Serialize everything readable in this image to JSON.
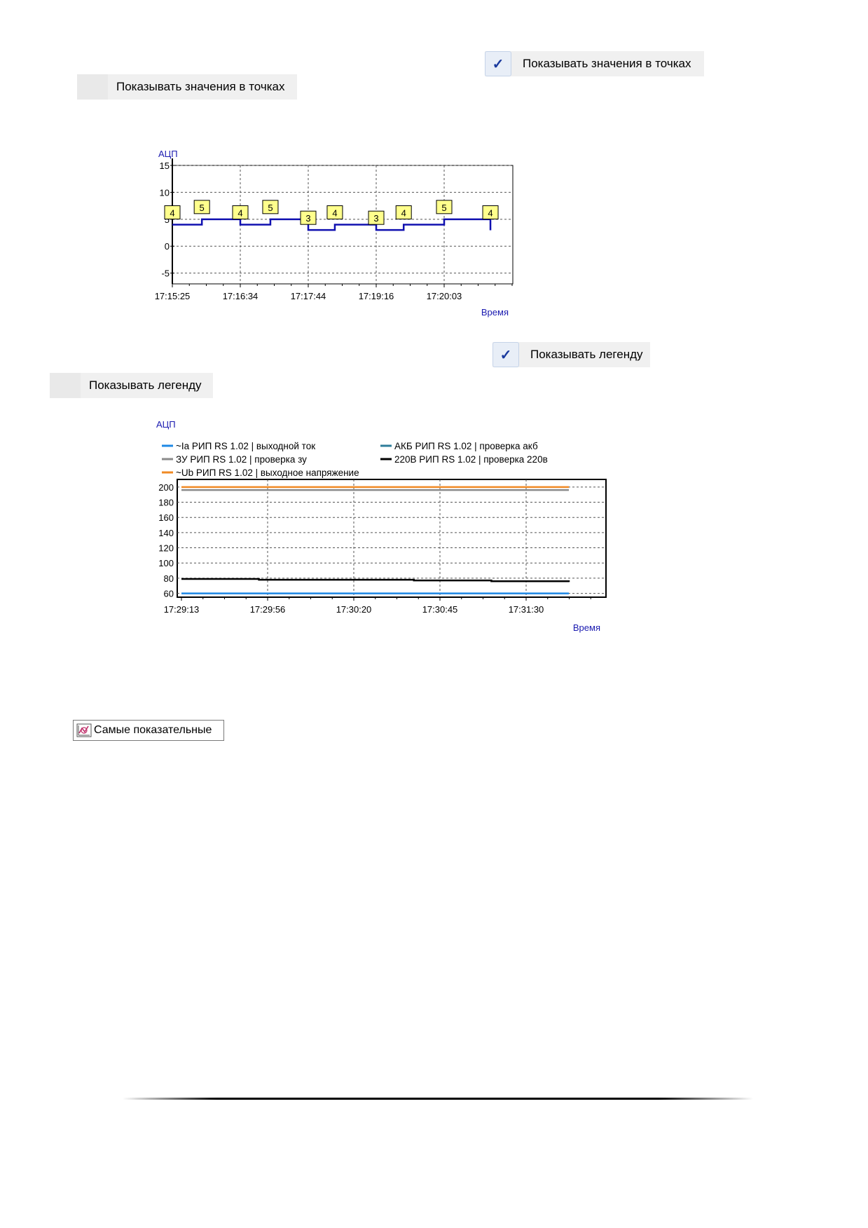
{
  "menu": {
    "show_values_checked": "Показывать значения в точках",
    "show_values_unchecked": "Показывать значения в точках",
    "show_legend_checked": "Показывать легенду",
    "show_legend_unchecked": "Показывать легенду",
    "check_glyph": "✓"
  },
  "toolbar": {
    "best_label": "Самые показательные"
  },
  "chart_data": [
    {
      "type": "line",
      "ylabel": "АЦП",
      "xlabel": "Время",
      "ylim": [
        -7,
        15
      ],
      "y_ticks": [
        15,
        10,
        5,
        0,
        -5
      ],
      "x_ticks": [
        "17:15:25",
        "17:16:34",
        "17:17:44",
        "17:19:16",
        "17:20:03"
      ],
      "grid": true,
      "legend": false,
      "series": [
        {
          "color": "#1010b0",
          "x": [
            "17:15:25",
            "17:15:55",
            "17:16:34",
            "17:17:05",
            "17:17:44",
            "17:18:20",
            "17:19:16",
            "17:19:35",
            "17:20:03",
            "17:20:35"
          ],
          "values": [
            4,
            5,
            4,
            5,
            3,
            4,
            3,
            4,
            5,
            4
          ],
          "point_labels": [
            "4",
            "5",
            "4",
            "5",
            "3",
            "4",
            "3",
            "4",
            "5",
            "4"
          ]
        }
      ]
    },
    {
      "type": "line",
      "ylabel": "АЦП",
      "xlabel": "Время",
      "ylim": [
        55,
        210
      ],
      "y_ticks": [
        200,
        180,
        160,
        140,
        120,
        100,
        80,
        60
      ],
      "x_ticks": [
        "17:29:13",
        "17:29:56",
        "17:30:20",
        "17:30:45",
        "17:31:30"
      ],
      "grid": true,
      "legend": "top",
      "series": [
        {
          "name": "~Ia РИП RS 1.02 | выходной ток",
          "color": "#1e88e5",
          "values": [
            60,
            60,
            60,
            60,
            60,
            60
          ]
        },
        {
          "name": "АКБ РИП RS 1.02 | проверка акб",
          "color": "#2e7d9a",
          "values": []
        },
        {
          "name": "ЗУ РИП RS 1.02 | проверка зу",
          "color": "#8a8a8a",
          "values": [
            196,
            196,
            196,
            196,
            196,
            196
          ]
        },
        {
          "name": "220В РИП RS 1.02 | проверка 220в",
          "color": "#000000",
          "values": [
            79,
            78,
            78,
            77,
            76,
            75
          ]
        },
        {
          "name": "~Ub РИП RS 1.02 | выходное напряжение",
          "color": "#f08a24",
          "values": [
            200,
            200,
            200,
            200,
            200,
            200
          ]
        }
      ]
    }
  ]
}
